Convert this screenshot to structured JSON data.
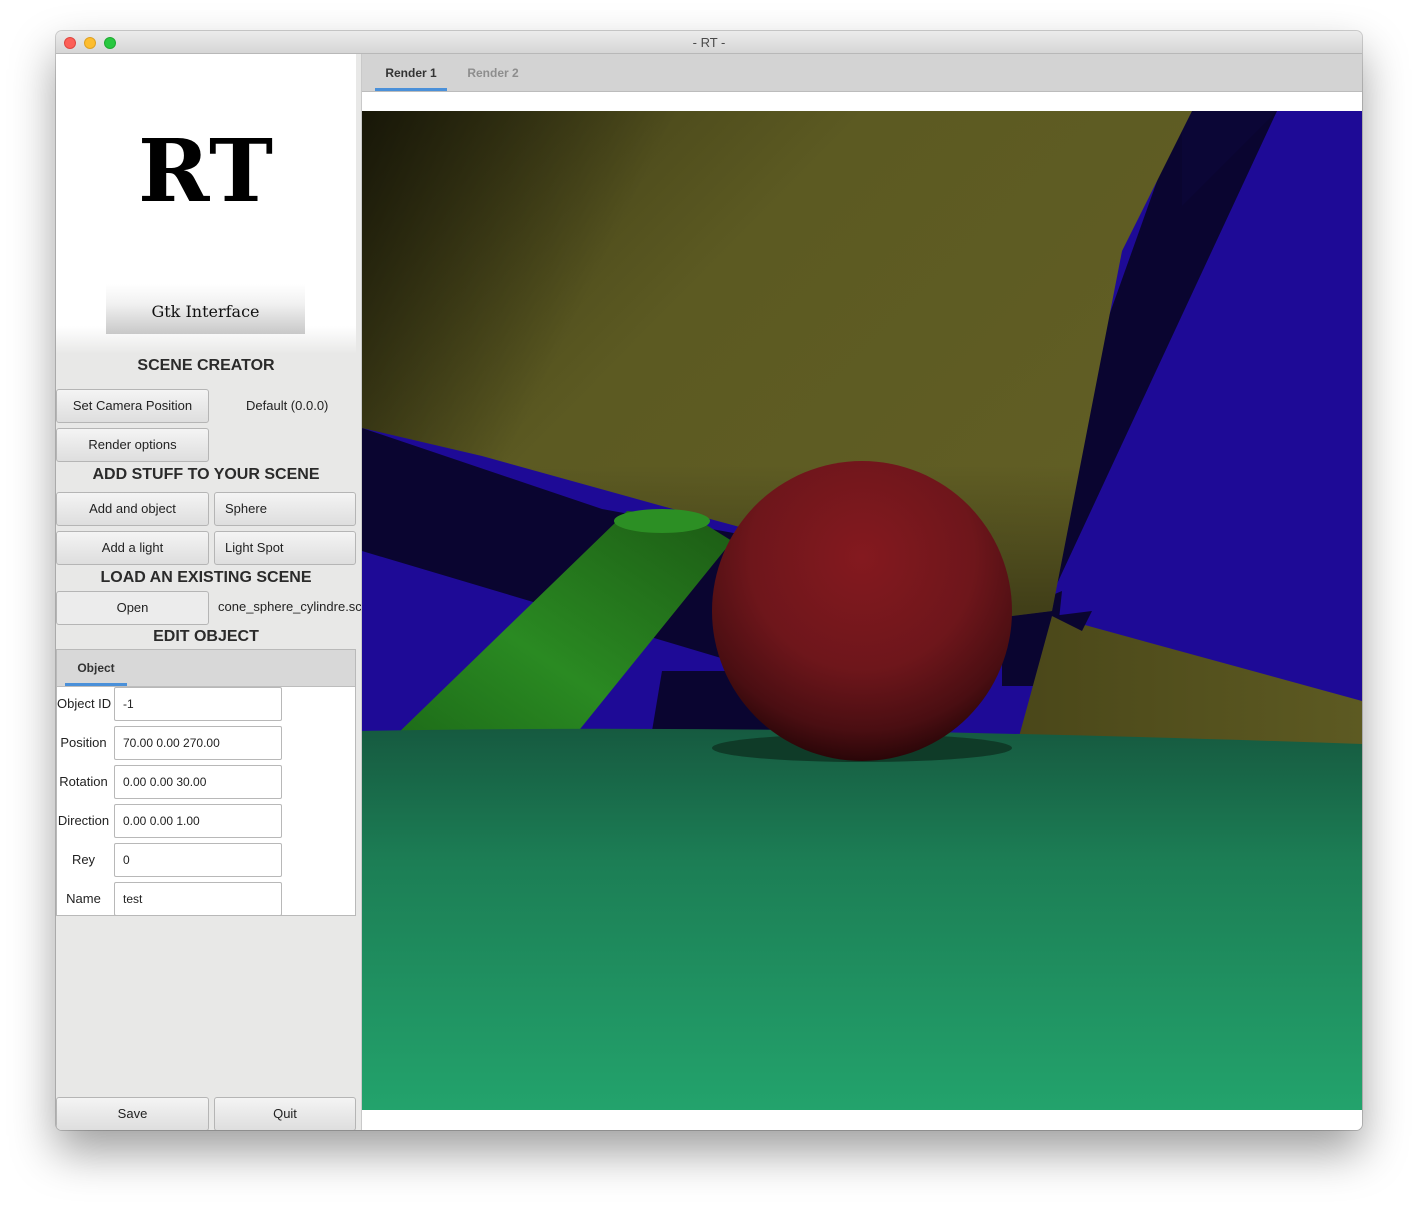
{
  "window": {
    "title": "- RT -"
  },
  "logo": {
    "title": "RT",
    "subtitle": "Gtk Interface"
  },
  "scene_creator": {
    "heading": "SCENE CREATOR",
    "camera_button": "Set Camera Position",
    "camera_value": "Default (0.0.0)",
    "render_options_button": "Render options"
  },
  "add_stuff": {
    "heading": "ADD STUFF TO YOUR SCENE",
    "add_object_button": "Add and object",
    "object_type": "Sphere",
    "add_light_button": "Add a light",
    "light_type": "Light Spot"
  },
  "load_scene": {
    "heading": "LOAD AN EXISTING SCENE",
    "open_button": "Open",
    "file_name": "cone_sphere_cylindre.sc"
  },
  "edit_object": {
    "heading": "EDIT OBJECT",
    "tab": "Object",
    "fields": [
      {
        "label": "Object ID",
        "value": "-1"
      },
      {
        "label": "Position",
        "value": "70.00 0.00 270.00"
      },
      {
        "label": "Rotation",
        "value": "0.00 0.00 30.00"
      },
      {
        "label": "Direction",
        "value": "0.00 0.00 1.00"
      },
      {
        "label": "Rey",
        "value": "0"
      },
      {
        "label": "Name",
        "value": "test"
      }
    ]
  },
  "footer": {
    "save_button": "Save",
    "quit_button": "Quit"
  },
  "render": {
    "tabs": [
      "Render 1",
      "Render 2"
    ],
    "active_tab": "Render 1"
  },
  "colors": {
    "accent": "#4a90d9",
    "cone": "#5d5a21",
    "wall": "#1e0a96",
    "floor": "#219c67",
    "sphere": "#7a1a20",
    "cylinder": "#2a8a22"
  }
}
